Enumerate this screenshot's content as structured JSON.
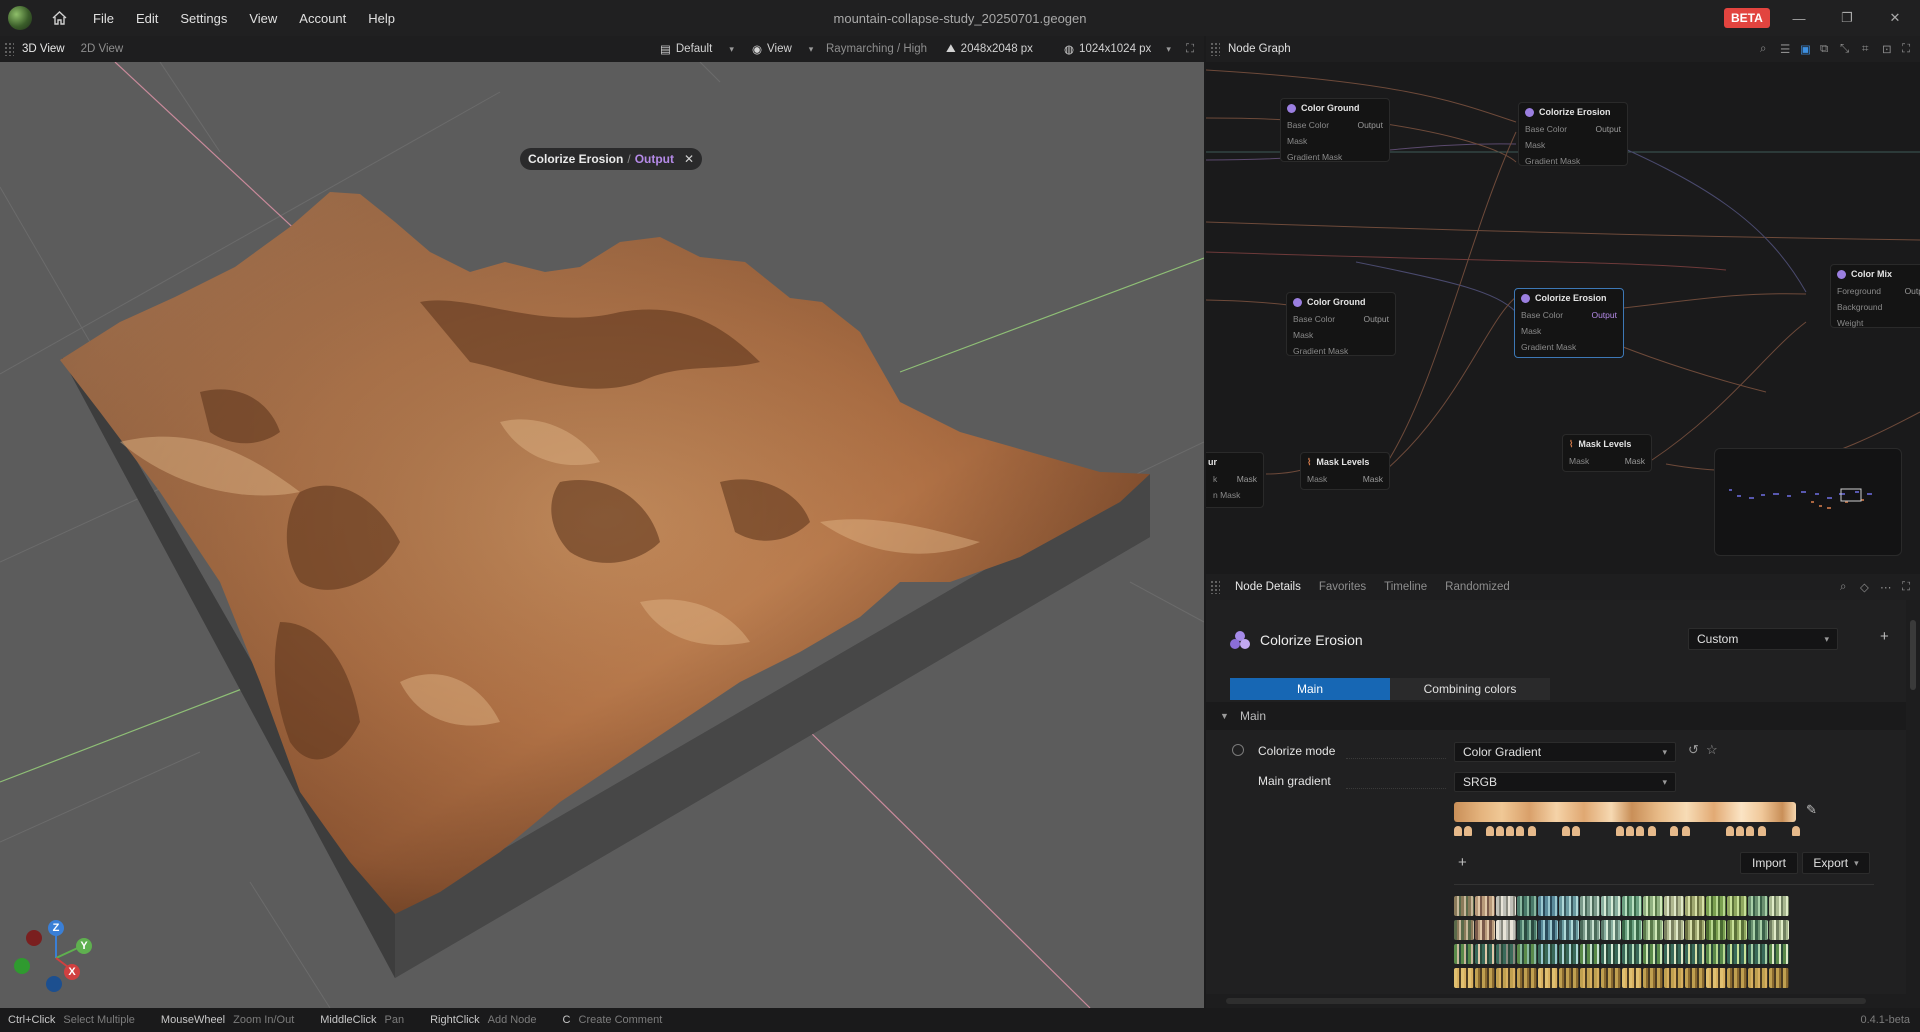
{
  "titlebar": {
    "menu": [
      "File",
      "Edit",
      "Settings",
      "View",
      "Account",
      "Help"
    ],
    "document_title": "mountain-collapse-study_20250701.geogen",
    "badge": "BETA"
  },
  "view_toolbar": {
    "tabs": [
      "3D View",
      "2D View"
    ],
    "layout": "Default",
    "view": "View",
    "render_mode": "Raymarching / High",
    "resolution": "2048x2048 px",
    "preview_resolution": "1024x1024 px"
  },
  "viewport": {
    "breadcrumb_node": "Colorize Erosion",
    "breadcrumb_sep": "/",
    "breadcrumb_port": "Output",
    "axes": {
      "z": "Z",
      "y": "Y",
      "x": "X"
    }
  },
  "node_graph": {
    "title": "Node Graph",
    "nodes": [
      {
        "title": "Color Ground",
        "rows": [
          "Base Color",
          "Mask",
          "Gradient Mask"
        ],
        "output": "Output"
      },
      {
        "title": "Colorize Erosion",
        "rows": [
          "Base Color",
          "Mask",
          "Gradient Mask"
        ],
        "output": "Output"
      },
      {
        "title": "Color Mix",
        "rows": [
          "Foreground",
          "Background",
          "Weight"
        ],
        "output": "Outp"
      },
      {
        "title": "Color Ground",
        "rows": [
          "Base Color",
          "Mask",
          "Gradient Mask"
        ],
        "output": "Output"
      },
      {
        "title": "Colorize Erosion",
        "rows": [
          "Base Color",
          "Mask",
          "Gradient Mask"
        ],
        "output": "Output"
      },
      {
        "title": "Mask Levels",
        "rows": [
          "Mask"
        ],
        "output": "Mask"
      },
      {
        "title": "Mask Levels",
        "rows": [
          "Mask"
        ],
        "output": "Mask"
      },
      {
        "title": "ur",
        "rows": [
          "k",
          "n Mask"
        ],
        "output": "Mask"
      }
    ]
  },
  "details": {
    "tabs": [
      "Node Details",
      "Favorites",
      "Timeline",
      "Randomized"
    ],
    "node_name": "Colorize Erosion",
    "preset": "Custom",
    "param_tabs": [
      "Main",
      "Combining colors"
    ],
    "section": "Main",
    "colorize_mode_label": "Colorize mode",
    "colorize_mode_value": "Color Gradient",
    "main_gradient_label": "Main gradient",
    "main_gradient_space": "SRGB",
    "import_label": "Import",
    "export_label": "Export",
    "add_label": "+"
  },
  "statusbar": {
    "hints": [
      {
        "key": "Ctrl+Click",
        "desc": "Select Multiple"
      },
      {
        "key": "MouseWheel",
        "desc": "Zoom In/Out"
      },
      {
        "key": "MiddleClick",
        "desc": "Pan"
      },
      {
        "key": "RightClick",
        "desc": "Add Node"
      },
      {
        "key": "C",
        "desc": "Create Comment"
      }
    ],
    "version": "0.4.1-beta"
  },
  "colors": {
    "accent": "#1767b4",
    "output_port": "#b58ae8",
    "beta": "#e2443f",
    "terrain": "#b87a4b"
  }
}
